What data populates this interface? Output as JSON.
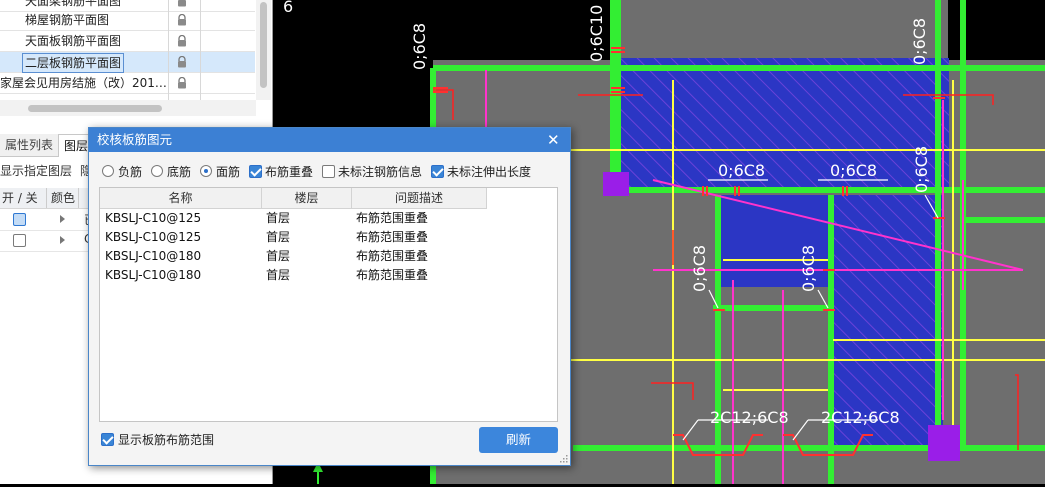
{
  "drawing_list": {
    "rows": [
      {
        "name": "天面梁钢筋平面图",
        "selected": false
      },
      {
        "name": "梯屋钢筋平面图",
        "selected": false
      },
      {
        "name": "天面板钢筋平面图",
        "selected": false
      },
      {
        "name": "二层板钢筋平面图",
        "selected": true
      },
      {
        "name": "家屋会见用房结施（改）201…",
        "selected": false
      }
    ]
  },
  "panel_tabs": {
    "properties": "属性列表",
    "layers": "图层"
  },
  "layer_panel": {
    "show_specified_layer": "显示指定图层",
    "hide_label": "隐",
    "col_toggle": "开 / 关",
    "col_color": "颜色",
    "rows": [
      {
        "checked": true,
        "text": "已"
      },
      {
        "checked": false,
        "text": "C"
      }
    ]
  },
  "dialog": {
    "title": "校核板筋图元",
    "close_glyph": "✕",
    "options": {
      "negative_rebar": {
        "label": "负筋",
        "selected": false
      },
      "bottom_rebar": {
        "label": "底筋",
        "selected": false
      },
      "top_rebar": {
        "label": "面筋",
        "selected": true
      },
      "overlap": {
        "label": "布筋重叠",
        "checked": true
      },
      "unlabeled_info": {
        "label": "未标注钢筋信息",
        "checked": false
      },
      "unlabeled_length": {
        "label": "未标注伸出长度",
        "checked": true
      }
    },
    "columns": {
      "name": "名称",
      "floor": "楼层",
      "issue": "问题描述"
    },
    "rows": [
      {
        "name": "KBSLJ-C10@125",
        "floor": "首层",
        "issue": "布筋范围重叠"
      },
      {
        "name": "KBSLJ-C10@125",
        "floor": "首层",
        "issue": "布筋范围重叠"
      },
      {
        "name": "KBSLJ-C10@180",
        "floor": "首层",
        "issue": "布筋范围重叠"
      },
      {
        "name": "KBSLJ-C10@180",
        "floor": "首层",
        "issue": "布筋范围重叠"
      }
    ],
    "show_range": {
      "label": "显示板筋布筋范围",
      "checked": true
    },
    "refresh_label": "刷新"
  },
  "cad_labels": {
    "top_left_vertical": "0;6C8",
    "top_mid_vertical": "0;6C10",
    "top_right_vertical": "0;6C8",
    "mid_label_1": "0;6C8",
    "mid_label_2": "0;6C8",
    "right_vertical": "0;6C8",
    "left_mid_vertical": "0;6C8",
    "center_mid_vertical": "0;6C8",
    "bottom_label_1": "2C12;6C8",
    "bottom_label_2": "2C12;6C8",
    "edge_glyph": "6"
  },
  "colors": {
    "accent": "#3c80d4",
    "slab_fill": "#2b36c4",
    "beam_green": "#33ee33",
    "rebar_yellow": "#ffff44",
    "rebar_magenta": "#ff33cc",
    "red_marks": "#ff2020",
    "column_purple": "#9a1ee8"
  }
}
